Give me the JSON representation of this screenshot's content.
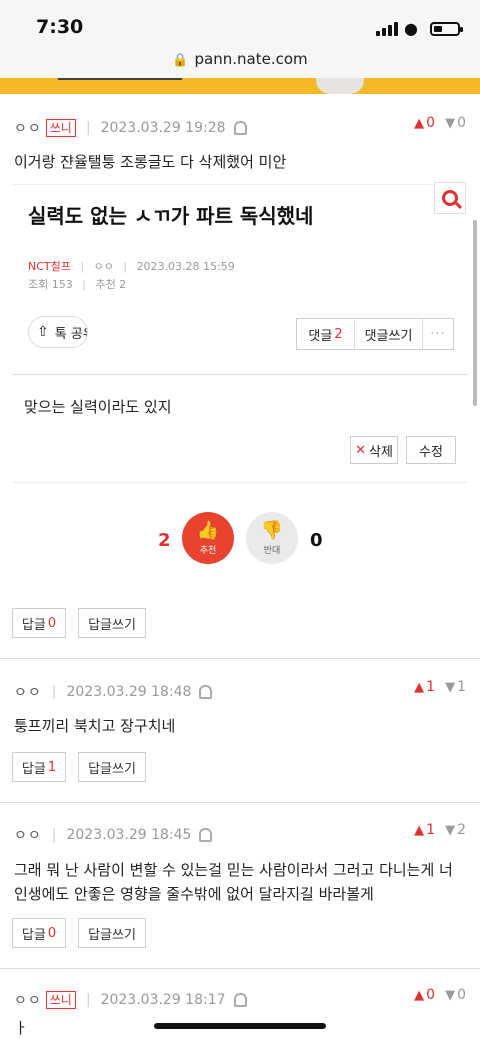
{
  "status_bar": {
    "time": "7:30"
  },
  "browser": {
    "url": "pann.nate.com"
  },
  "comments": [
    {
      "user": "ㅇㅇ",
      "badge": "쓰니",
      "timestamp": "2023.03.29 19:28",
      "up": "0",
      "down": "0",
      "text": "이거랑 쟌율탤퉁 조롱글도 다 삭제했어 미안",
      "reply_count": "0"
    },
    {
      "user": "ㅇㅇ",
      "timestamp": "2023.03.29 18:48",
      "up": "1",
      "down": "1",
      "text": "퉁프끼리 북치고 장구치네",
      "reply_count": "1"
    },
    {
      "user": "ㅇㅇ",
      "timestamp": "2023.03.29 18:45",
      "up": "1",
      "down": "2",
      "text": "그래 뭐 난 사람이 변할 수 있는걸 믿는 사람이라서 그러고 다니는게 너 인생에도 안좋은 영향을 줄수밖에 없어 달라지길 바라볼게",
      "reply_count": "0"
    },
    {
      "user": "ㅇㅇ",
      "badge": "쓰니",
      "timestamp": "2023.03.29 18:17",
      "up": "0",
      "down": "0",
      "text": "ㅏ"
    }
  ],
  "labels": {
    "reply": "답글",
    "write_reply": "답글쓰기"
  },
  "embedded_post": {
    "title": "실력도 없는 ㅅㄲ가 파트 독식했네",
    "author": "NCT칠프",
    "user": "ㅇㅇ",
    "timestamp": "2023.03.28 15:59",
    "views": "조회 153",
    "recommends": "추천 2",
    "share_label": "톡 공유",
    "comment_label": "댓글",
    "comment_count": "2",
    "write_comment_label": "댓글쓰기",
    "more_label": "···",
    "body": "맞으는 실력이라도 있지",
    "delete_label": "삭제",
    "edit_label": "수정",
    "recommend_count": "2",
    "recommend_label": "추천",
    "oppose_count": "0",
    "oppose_label": "반대"
  },
  "colors": {
    "accent": "#e03131",
    "banner": "#f4b829"
  }
}
